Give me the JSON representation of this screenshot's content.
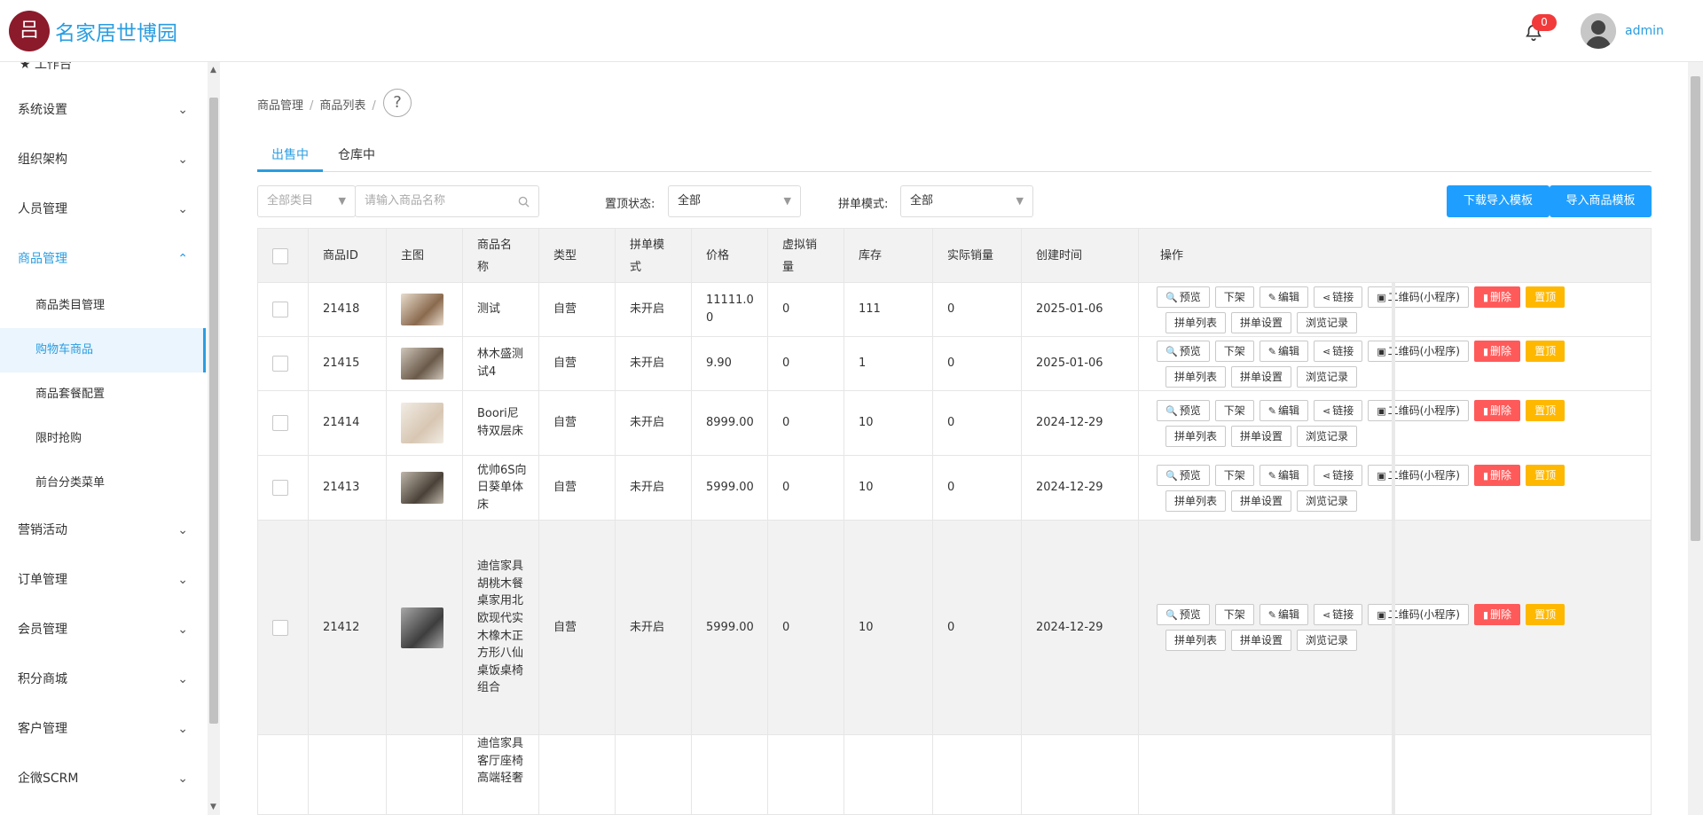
{
  "brand": {
    "logo_glyph": "吕",
    "name": "名家居世博园"
  },
  "header": {
    "notification_count": "0",
    "user": "admin"
  },
  "sidebar": {
    "partial_top": "工作台",
    "items": [
      {
        "label": "系统设置"
      },
      {
        "label": "组织架构"
      },
      {
        "label": "人员管理"
      },
      {
        "label": "商品管理"
      },
      {
        "label": "营销活动"
      },
      {
        "label": "订单管理"
      },
      {
        "label": "会员管理"
      },
      {
        "label": "积分商城"
      },
      {
        "label": "客户管理"
      },
      {
        "label": "企微SCRM"
      }
    ],
    "subitems": [
      {
        "label": "商品类目管理"
      },
      {
        "label": "购物车商品"
      },
      {
        "label": "商品套餐配置"
      },
      {
        "label": "限时抢购"
      },
      {
        "label": "前台分类菜单"
      }
    ]
  },
  "breadcrumb": {
    "first": "商品管理",
    "second": "商品列表",
    "sep": "/",
    "help": "?"
  },
  "tabs": [
    {
      "label": "出售中"
    },
    {
      "label": "仓库中"
    }
  ],
  "filters": {
    "category_placeholder": "全部类目",
    "search_placeholder": "请输入商品名称",
    "top_status_label": "置顶状态:",
    "top_status_value": "全部",
    "group_mode_label": "拼单模式:",
    "group_mode_value": "全部",
    "download_template": "下载导入模板",
    "import_template": "导入商品模板"
  },
  "table": {
    "columns": [
      "商品ID",
      "主图",
      "商品名称",
      "类型",
      "拼单模式",
      "价格",
      "虚拟销量",
      "库存",
      "实际销量",
      "创建时间",
      "操作"
    ],
    "actions": {
      "preview": "预览",
      "offshelf": "下架",
      "edit": "编辑",
      "link": "链接",
      "qrcode": "二维码(小程序)",
      "delete": "删除",
      "pin": "置顶",
      "group_list": "拼单列表",
      "group_settings": "拼单设置",
      "browse_log": "浏览记录"
    },
    "rows": [
      {
        "id": "21418",
        "name": "测试",
        "type": "自营",
        "group_mode": "未开启",
        "price": "11111.00",
        "virtual_sales": "0",
        "stock": "111",
        "actual_sales": "0",
        "created": "2025-01-06"
      },
      {
        "id": "21415",
        "name": "林木盛测试4",
        "type": "自营",
        "group_mode": "未开启",
        "price": "9.90",
        "virtual_sales": "0",
        "stock": "1",
        "actual_sales": "0",
        "created": "2025-01-06"
      },
      {
        "id": "21414",
        "name": "Boori尼特双层床",
        "type": "自营",
        "group_mode": "未开启",
        "price": "8999.00",
        "virtual_sales": "0",
        "stock": "10",
        "actual_sales": "0",
        "created": "2024-12-29"
      },
      {
        "id": "21413",
        "name": "优帅6S向日葵单体床",
        "type": "自营",
        "group_mode": "未开启",
        "price": "5999.00",
        "virtual_sales": "0",
        "stock": "10",
        "actual_sales": "0",
        "created": "2024-12-29"
      },
      {
        "id": "21412",
        "name": "迪信家具胡桃木餐桌家用北欧现代实木橡木正方形八仙桌饭桌椅组合",
        "type": "自营",
        "group_mode": "未开启",
        "price": "5999.00",
        "virtual_sales": "0",
        "stock": "10",
        "actual_sales": "0",
        "created": "2024-12-29"
      },
      {
        "id": "",
        "name": "迪信家具客厅座椅高端轻奢",
        "type": "",
        "group_mode": "",
        "price": "",
        "virtual_sales": "",
        "stock": "",
        "actual_sales": "",
        "created": ""
      }
    ]
  },
  "colors": {
    "accent": "#2a9de0",
    "brand": "#8b1a2b",
    "danger": "#ff5a5a",
    "warning": "#ffb800",
    "primary_button": "#1e9fff"
  }
}
